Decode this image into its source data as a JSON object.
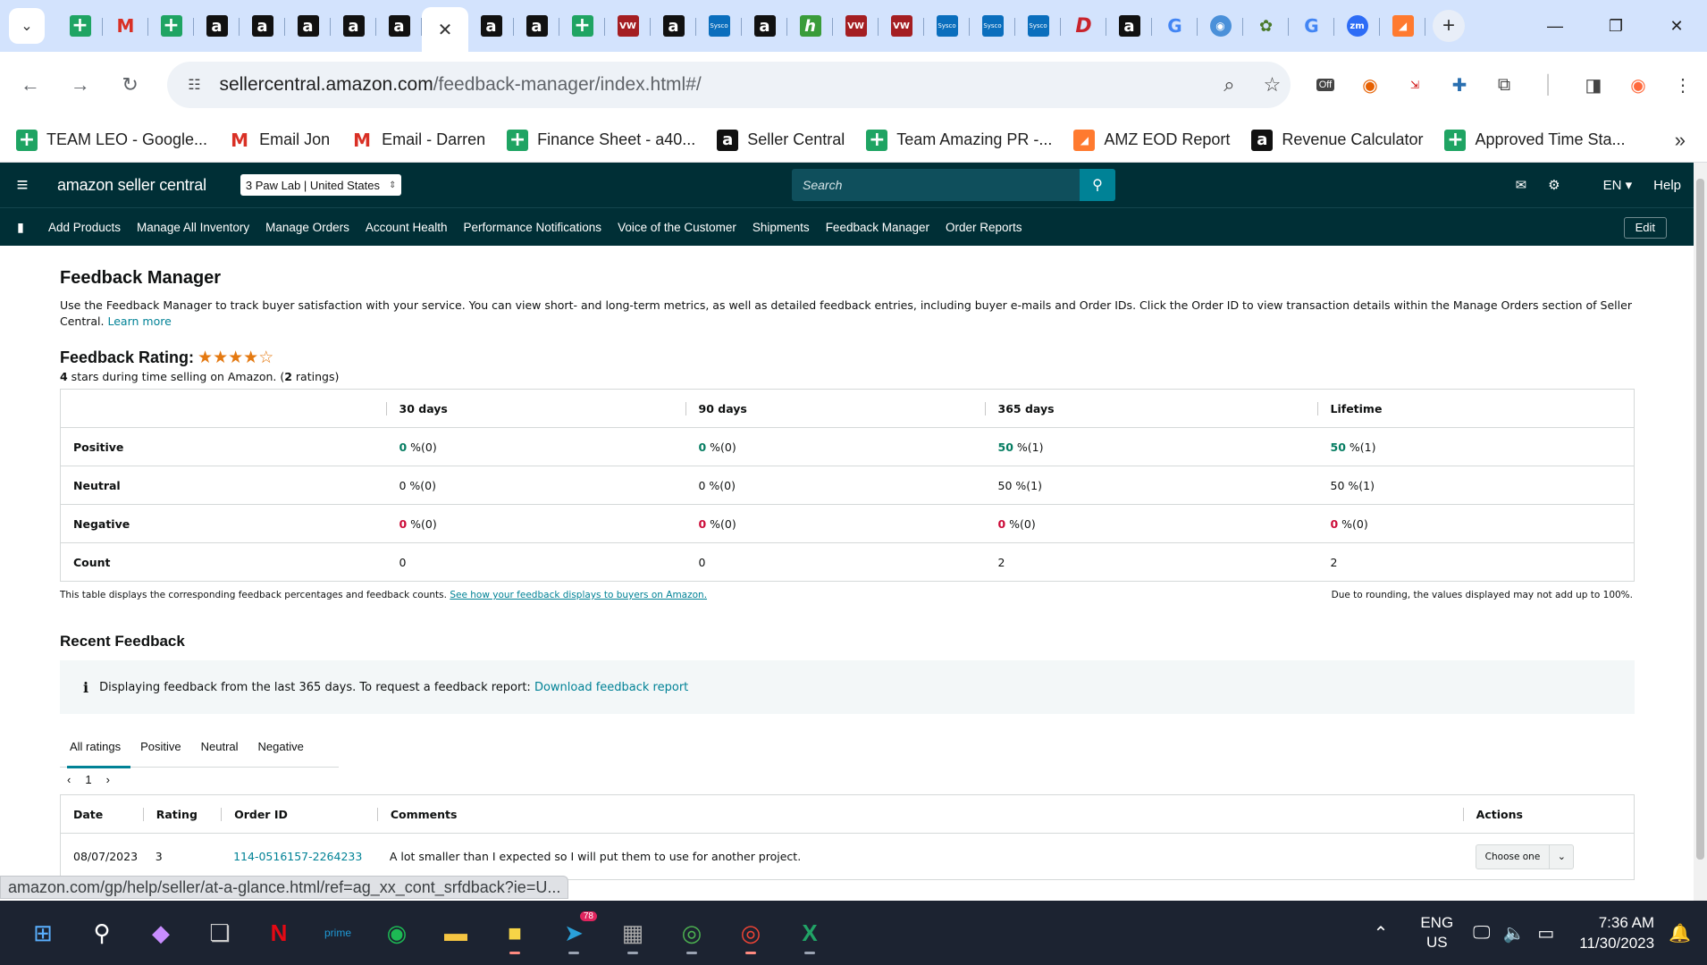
{
  "browser": {
    "tabs": [
      {
        "icon": "sheets-icon",
        "kind": "sheet",
        "glyph": "+"
      },
      {
        "icon": "gmail-icon",
        "kind": "gmail",
        "glyph": "M"
      },
      {
        "icon": "sheets-icon",
        "kind": "sheet",
        "glyph": "+"
      },
      {
        "icon": "amazon-icon",
        "kind": "amz",
        "glyph": "a"
      },
      {
        "icon": "amazon-icon",
        "kind": "amz",
        "glyph": "a"
      },
      {
        "icon": "amazon-icon",
        "kind": "amz",
        "glyph": "a"
      },
      {
        "icon": "amazon-icon",
        "kind": "amz",
        "glyph": "a"
      },
      {
        "icon": "amazon-icon",
        "kind": "amz",
        "glyph": "a"
      },
      {
        "icon": "close-icon",
        "kind": "active",
        "glyph": "✕"
      },
      {
        "icon": "amazon-icon",
        "kind": "amz",
        "glyph": "a"
      },
      {
        "icon": "amazon-icon",
        "kind": "amz",
        "glyph": "a"
      },
      {
        "icon": "sheets-icon",
        "kind": "sheet",
        "glyph": "+"
      },
      {
        "icon": "vw-icon",
        "kind": "vw",
        "glyph": "VW"
      },
      {
        "icon": "amazon-icon",
        "kind": "amz",
        "glyph": "a"
      },
      {
        "icon": "sysco-icon",
        "kind": "sysco",
        "glyph": "Sysco"
      },
      {
        "icon": "amazon-icon",
        "kind": "amz",
        "glyph": "a"
      },
      {
        "icon": "leaf-app-icon",
        "kind": "green",
        "glyph": "h"
      },
      {
        "icon": "vw-icon",
        "kind": "vw",
        "glyph": "VW"
      },
      {
        "icon": "vw-icon",
        "kind": "vw",
        "glyph": "VW"
      },
      {
        "icon": "sysco-icon",
        "kind": "sysco",
        "glyph": "Sysco"
      },
      {
        "icon": "sysco-icon",
        "kind": "sysco",
        "glyph": "Sysco"
      },
      {
        "icon": "sysco-icon",
        "kind": "sysco",
        "glyph": "Sysco"
      },
      {
        "icon": "pinterest-icon",
        "kind": "pin",
        "glyph": "D"
      },
      {
        "icon": "amazon-icon",
        "kind": "amz",
        "glyph": "a"
      },
      {
        "icon": "google-icon",
        "kind": "goog",
        "glyph": "G"
      },
      {
        "icon": "globe-icon",
        "kind": "globe",
        "glyph": "◉"
      },
      {
        "icon": "plant-icon",
        "kind": "plant",
        "glyph": "✿"
      },
      {
        "icon": "google-icon",
        "kind": "goog",
        "glyph": "G"
      },
      {
        "icon": "zoom-icon",
        "kind": "zoom",
        "glyph": "zm"
      },
      {
        "icon": "orange-app-icon",
        "kind": "orange",
        "glyph": "◢"
      }
    ],
    "url_domain": "sellercentral.amazon.com",
    "url_path": "/feedback-manager/index.html#/",
    "extension_off_label": "Off",
    "bookmarks": [
      {
        "icon": "sheets-icon",
        "kind": "sheet",
        "glyph": "+",
        "label": "TEAM LEO - Google..."
      },
      {
        "icon": "gmail-icon",
        "kind": "gmail",
        "glyph": "M",
        "label": "Email Jon"
      },
      {
        "icon": "gmail-icon",
        "kind": "gmail",
        "glyph": "M",
        "label": "Email - Darren"
      },
      {
        "icon": "sheets-icon",
        "kind": "sheet",
        "glyph": "+",
        "label": "Finance Sheet - a40..."
      },
      {
        "icon": "amazon-icon",
        "kind": "amz",
        "glyph": "a",
        "label": "Seller Central"
      },
      {
        "icon": "sheets-icon",
        "kind": "sheet",
        "glyph": "+",
        "label": "Team Amazing PR -..."
      },
      {
        "icon": "orange-app-icon",
        "kind": "orange",
        "glyph": "◢",
        "label": "AMZ EOD Report"
      },
      {
        "icon": "amazon-icon",
        "kind": "amz",
        "glyph": "a",
        "label": "Revenue Calculator"
      },
      {
        "icon": "sheets-icon",
        "kind": "sheet",
        "glyph": "+",
        "label": "Approved Time Sta..."
      }
    ]
  },
  "seller_central": {
    "logo": "amazon seller central",
    "store": "3 Paw Lab | United States",
    "search_placeholder": "Search",
    "lang": "EN",
    "help": "Help",
    "nav": [
      "Add Products",
      "Manage All Inventory",
      "Manage Orders",
      "Account Health",
      "Performance Notifications",
      "Voice of the Customer",
      "Shipments",
      "Feedback Manager",
      "Order Reports"
    ],
    "edit": "Edit"
  },
  "page": {
    "title": "Feedback Manager",
    "description": "Use the Feedback Manager to track buyer satisfaction with your service. You can view short- and long-term metrics, as well as detailed feedback entries, including buyer e-mails and Order IDs. Click the Order ID to view transaction details within the Manage Orders section of Seller Central.",
    "learn_more": "Learn more",
    "rating_label": "Feedback Rating:",
    "rating_stars": 4,
    "rating_sub_stars": "4",
    "rating_sub_text1": " stars during time selling on Amazon. (",
    "rating_sub_count": "2",
    "rating_sub_text2": " ratings)",
    "metrics": {
      "columns": [
        "30 days",
        "90 days",
        "365 days",
        "Lifetime"
      ],
      "rows": [
        {
          "label": "Positive",
          "cells": [
            [
              "0",
              " %(0)"
            ],
            [
              "0",
              " %(0)"
            ],
            [
              "50",
              " %(1)"
            ],
            [
              "50",
              " %(1)"
            ]
          ],
          "tone": "pos"
        },
        {
          "label": "Neutral",
          "cells": [
            [
              "0",
              " %(0)"
            ],
            [
              "0",
              " %(0)"
            ],
            [
              "50",
              " %(1)"
            ],
            [
              "50",
              " %(1)"
            ]
          ],
          "tone": ""
        },
        {
          "label": "Negative",
          "cells": [
            [
              "0",
              " %(0)"
            ],
            [
              "0",
              " %(0)"
            ],
            [
              "0",
              " %(0)"
            ],
            [
              "0",
              " %(0)"
            ]
          ],
          "tone": "neg"
        },
        {
          "label": "Count",
          "cells": [
            [
              "0",
              ""
            ],
            [
              "0",
              ""
            ],
            [
              "2",
              ""
            ],
            [
              "2",
              ""
            ]
          ],
          "tone": ""
        }
      ]
    },
    "table_note": "This table displays the corresponding feedback percentages and feedback counts.",
    "table_note_link": "See how your feedback displays to buyers on Amazon.",
    "rounding_note": "Due to rounding, the values displayed may not add up to 100%.",
    "recent_title": "Recent Feedback",
    "info_text": "Displaying feedback from the last 365 days. To request a feedback report:",
    "info_link": "Download feedback report",
    "rating_tabs": [
      "All ratings",
      "Positive",
      "Neutral",
      "Negative"
    ],
    "page_number": "1",
    "feedback_columns": [
      "Date",
      "Rating",
      "Order ID",
      "Comments",
      "Actions"
    ],
    "feedback_rows": [
      {
        "date": "08/07/2023",
        "rating": "3",
        "order_id": "114-0516157-2264233",
        "comment": "A lot smaller than I expected so I will put them to use for another project.",
        "action": "Choose one"
      }
    ]
  },
  "status_bar_url": "amazon.com/gp/help/seller/at-a-glance.html/ref=ag_xx_cont_srfdback?ie=U...",
  "taskbar": {
    "telegram_badge": "78",
    "lang_line1": "ENG",
    "lang_line2": "US",
    "time": "7:36 AM",
    "date": "11/30/2023"
  }
}
